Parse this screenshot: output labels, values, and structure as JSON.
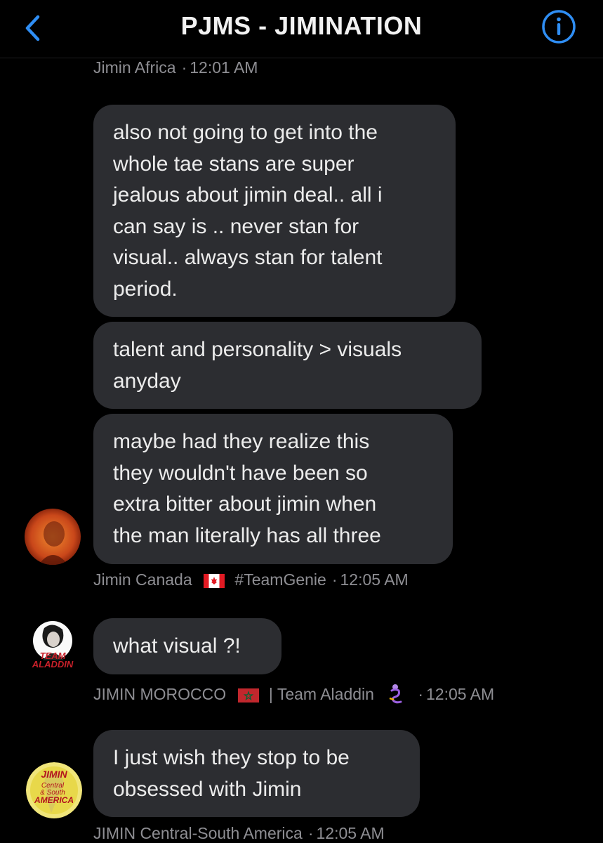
{
  "header": {
    "back_icon": "chevron-left-icon",
    "title": "PJMS - JIMINATION",
    "info_icon": "info-circle-icon",
    "accent": "#2f8ef4"
  },
  "messages": [
    {
      "sender": "Jimin Africa",
      "time": "12:01 AM"
    },
    {
      "bubbles": [
        "also not going to get into the\nwhole tae stans are super\njealous about jimin deal.. all i\ncan say is .. never stan for\nvisual.. always stan for talent\nperiod.",
        "talent and personality > visuals\nanyday",
        "maybe had they realize this\nthey wouldn't have been so\nextra bitter about jimin when\nthe man literally has all three"
      ],
      "sender_name": "Jimin Canada",
      "sender_tag": "#TeamGenie",
      "time": "12:05 AM"
    },
    {
      "bubbles": [
        "what visual ?!"
      ],
      "avatar_text_1": "TEAM",
      "avatar_text_2": "ALADDIN",
      "sender_name": "JIMIN MOROCCO",
      "sender_tag": "| Team Aladdin",
      "time": "12:05 AM"
    },
    {
      "bubbles": [
        "I just wish they stop to be\nobsessed with Jimin"
      ],
      "avatar_text_1": "JIMIN",
      "avatar_text_2": "Central",
      "avatar_text_3": "& South",
      "avatar_text_4": "AMERICA",
      "sender": "JIMIN Central-South America",
      "time": "12:05 AM"
    }
  ],
  "colors": {
    "background": "#000000",
    "bubble": "#2c2d31",
    "meta_text": "#8e8e93"
  }
}
